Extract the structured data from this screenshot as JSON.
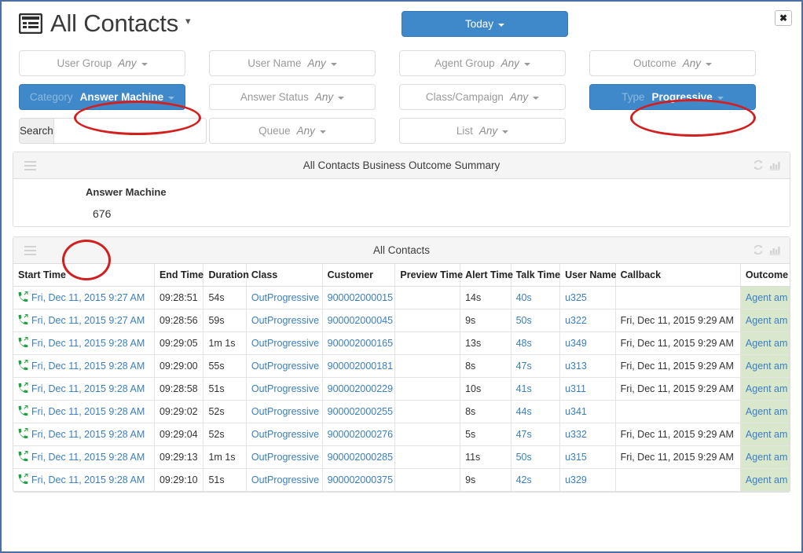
{
  "header": {
    "title": "All Contacts",
    "title_caret": "▾",
    "title_icon": "list-window-icon",
    "today_button": "Today",
    "close_button": "✖"
  },
  "filters": {
    "any_label": "Any",
    "rows": [
      [
        {
          "label": "User Group",
          "value": "Any",
          "active": false,
          "name": "filter-user-group"
        },
        {
          "label": "User Name",
          "value": "Any",
          "active": false,
          "name": "filter-user-name"
        },
        {
          "label": "Agent Group",
          "value": "Any",
          "active": false,
          "name": "filter-agent-group"
        },
        {
          "label": "Outcome",
          "value": "Any",
          "active": false,
          "name": "filter-outcome"
        }
      ],
      [
        {
          "label": "Category",
          "value": "Answer Machine",
          "active": true,
          "name": "filter-category"
        },
        {
          "label": "Answer Status",
          "value": "Any",
          "active": false,
          "name": "filter-answer-status"
        },
        {
          "label": "Class/Campaign",
          "value": "Any",
          "active": false,
          "name": "filter-class-campaign"
        },
        {
          "label": "Type",
          "value": "Progressive",
          "active": true,
          "name": "filter-type"
        }
      ],
      [
        {
          "label": "Search",
          "value": "",
          "active": false,
          "name": "filter-search",
          "is_search": true
        },
        {
          "label": "Queue",
          "value": "Any",
          "active": false,
          "name": "filter-queue"
        },
        {
          "label": "List",
          "value": "Any",
          "active": false,
          "name": "filter-list"
        },
        {
          "label": "",
          "value": "",
          "active": false,
          "name": "filter-empty",
          "empty": true
        }
      ]
    ],
    "search": {
      "label": "Search",
      "value": "",
      "placeholder": ""
    }
  },
  "summary_panel": {
    "title": "All Contacts Business Outcome Summary",
    "menu_icon": "hamburger-icon",
    "refresh_icon": "refresh-icon",
    "chart_icon": "bar-chart-icon",
    "metric_label": "Answer Machine",
    "metric_value": "676"
  },
  "contacts_panel": {
    "title": "All Contacts",
    "menu_icon": "hamburger-icon",
    "refresh_icon": "refresh-icon",
    "chart_icon": "bar-chart-icon",
    "columns": [
      "Start Time",
      "End Time",
      "Duration",
      "Class",
      "Customer",
      "Preview Time",
      "Alert Time",
      "Talk Time",
      "User Name",
      "Callback",
      "Outcome"
    ],
    "rows": [
      {
        "start_time": "Fri, Dec 11, 2015 9:27 AM",
        "end_time": "09:28:51",
        "duration": "54s",
        "class": "OutProgressive",
        "customer": "900002000015",
        "preview_time": "",
        "alert_time": "14s",
        "talk_time": "40s",
        "user_name": "u325",
        "callback": "",
        "outcome": "Agent am"
      },
      {
        "start_time": "Fri, Dec 11, 2015 9:27 AM",
        "end_time": "09:28:56",
        "duration": "59s",
        "class": "OutProgressive",
        "customer": "900002000045",
        "preview_time": "",
        "alert_time": "9s",
        "talk_time": "50s",
        "user_name": "u322",
        "callback": "Fri, Dec 11, 2015 9:29 AM",
        "outcome": "Agent am"
      },
      {
        "start_time": "Fri, Dec 11, 2015 9:28 AM",
        "end_time": "09:29:05",
        "duration": "1m 1s",
        "class": "OutProgressive",
        "customer": "900002000165",
        "preview_time": "",
        "alert_time": "13s",
        "talk_time": "48s",
        "user_name": "u349",
        "callback": "Fri, Dec 11, 2015 9:29 AM",
        "outcome": "Agent am"
      },
      {
        "start_time": "Fri, Dec 11, 2015 9:28 AM",
        "end_time": "09:29:00",
        "duration": "55s",
        "class": "OutProgressive",
        "customer": "900002000181",
        "preview_time": "",
        "alert_time": "8s",
        "talk_time": "47s",
        "user_name": "u313",
        "callback": "Fri, Dec 11, 2015 9:29 AM",
        "outcome": "Agent am"
      },
      {
        "start_time": "Fri, Dec 11, 2015 9:28 AM",
        "end_time": "09:28:58",
        "duration": "51s",
        "class": "OutProgressive",
        "customer": "900002000229",
        "preview_time": "",
        "alert_time": "10s",
        "talk_time": "41s",
        "user_name": "u311",
        "callback": "Fri, Dec 11, 2015 9:29 AM",
        "outcome": "Agent am"
      },
      {
        "start_time": "Fri, Dec 11, 2015 9:28 AM",
        "end_time": "09:29:02",
        "duration": "52s",
        "class": "OutProgressive",
        "customer": "900002000255",
        "preview_time": "",
        "alert_time": "8s",
        "talk_time": "44s",
        "user_name": "u341",
        "callback": "",
        "outcome": "Agent am"
      },
      {
        "start_time": "Fri, Dec 11, 2015 9:28 AM",
        "end_time": "09:29:04",
        "duration": "52s",
        "class": "OutProgressive",
        "customer": "900002000276",
        "preview_time": "",
        "alert_time": "5s",
        "talk_time": "47s",
        "user_name": "u332",
        "callback": "Fri, Dec 11, 2015 9:29 AM",
        "outcome": "Agent am"
      },
      {
        "start_time": "Fri, Dec 11, 2015 9:28 AM",
        "end_time": "09:29:13",
        "duration": "1m 1s",
        "class": "OutProgressive",
        "customer": "900002000285",
        "preview_time": "",
        "alert_time": "11s",
        "talk_time": "50s",
        "user_name": "u315",
        "callback": "Fri, Dec 11, 2015 9:29 AM",
        "outcome": "Agent am"
      },
      {
        "start_time": "Fri, Dec 11, 2015 9:28 AM",
        "end_time": "09:29:10",
        "duration": "51s",
        "class": "OutProgressive",
        "customer": "900002000375",
        "preview_time": "",
        "alert_time": "9s",
        "talk_time": "42s",
        "user_name": "u329",
        "callback": "",
        "outcome": "Agent am"
      }
    ]
  },
  "annotations": [
    {
      "name": "annotation-ellipse-answer-machine",
      "color": "#d21f1f"
    },
    {
      "name": "annotation-ellipse-progressive",
      "color": "#d21f1f"
    },
    {
      "name": "annotation-ellipse-count",
      "color": "#d21f1f"
    }
  ],
  "colors": {
    "accent": "#3f89cb",
    "link": "#3a7fc1",
    "outcome_bg": "#d9e7cd",
    "annotation": "#d21f1f",
    "window_border": "#4a6fa5"
  }
}
